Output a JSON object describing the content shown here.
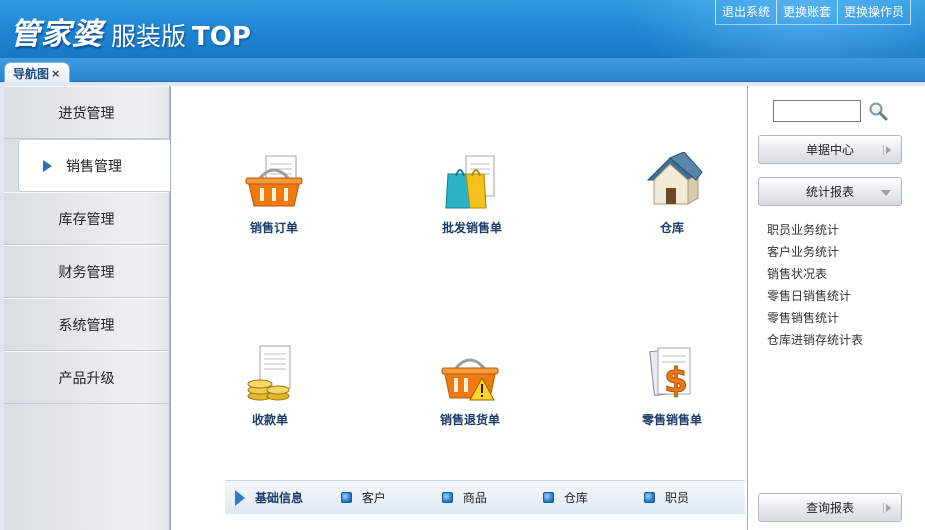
{
  "header": {
    "logo_main": "管家婆",
    "logo_sub": "服装版",
    "logo_top": "TOP",
    "links": [
      "退出系统",
      "更换账套",
      "更换操作员"
    ]
  },
  "tabs": [
    {
      "label": "导航图",
      "close": "×"
    }
  ],
  "sidebar": {
    "items": [
      {
        "label": "进货管理"
      },
      {
        "label": "销售管理",
        "active": true
      },
      {
        "label": "库存管理"
      },
      {
        "label": "财务管理"
      },
      {
        "label": "系统管理"
      },
      {
        "label": "产品升级"
      }
    ]
  },
  "main": {
    "functions": [
      {
        "label": "销售订单",
        "icon": "basket-document-icon"
      },
      {
        "label": "批发销售单",
        "icon": "shopping-bag-document-icon"
      },
      {
        "label": "仓库",
        "icon": "warehouse-house-icon"
      },
      {
        "label": "收款单",
        "icon": "coins-document-icon"
      },
      {
        "label": "销售退货单",
        "icon": "basket-warning-icon"
      },
      {
        "label": "零售销售单",
        "icon": "dollar-document-icon"
      }
    ],
    "basic_info": {
      "title": "基础信息",
      "links": [
        "客户",
        "商品",
        "仓库",
        "职员"
      ]
    }
  },
  "right_panel": {
    "search_value": "",
    "buttons": {
      "doc_center": "单据中心",
      "stats_report": "统计报表",
      "query_report": "查询报表"
    },
    "report_links": [
      "职员业务统计",
      "客户业务统计",
      "销售状况表",
      "零售日销售统计",
      "零售销售统计",
      "仓库进销存统计表"
    ]
  },
  "colors": {
    "header_blue": "#1e86d3",
    "accent_orange": "#f07a10",
    "label_navy": "#1d3c6a"
  }
}
